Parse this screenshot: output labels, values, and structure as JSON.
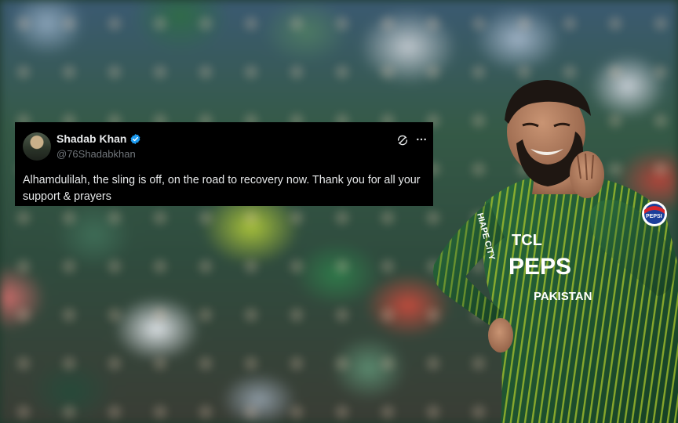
{
  "tweet": {
    "author_name": "Shadab Khan",
    "handle": "@76Shadabkhan",
    "text": "Alhamdulilah, the sling is off, on the road to recovery now. Thank you for all your support & prayers",
    "verified": true
  },
  "jersey": {
    "line1": "TCL",
    "line2": "PEPS",
    "line3": "PAKISTAN",
    "sleeve_left": "HIAPE CITY",
    "badge": "PEPSI"
  },
  "icons": {
    "verified": "verified-badge-icon",
    "grok": "grok-icon",
    "more": "more-options-icon"
  },
  "colors": {
    "card_bg": "#000000",
    "text": "#e7e9ea",
    "handle": "#71767b",
    "verified_blue": "#1d9bf0",
    "jersey_green": "#1f5a32",
    "jersey_stripe": "#b7cf2a"
  }
}
